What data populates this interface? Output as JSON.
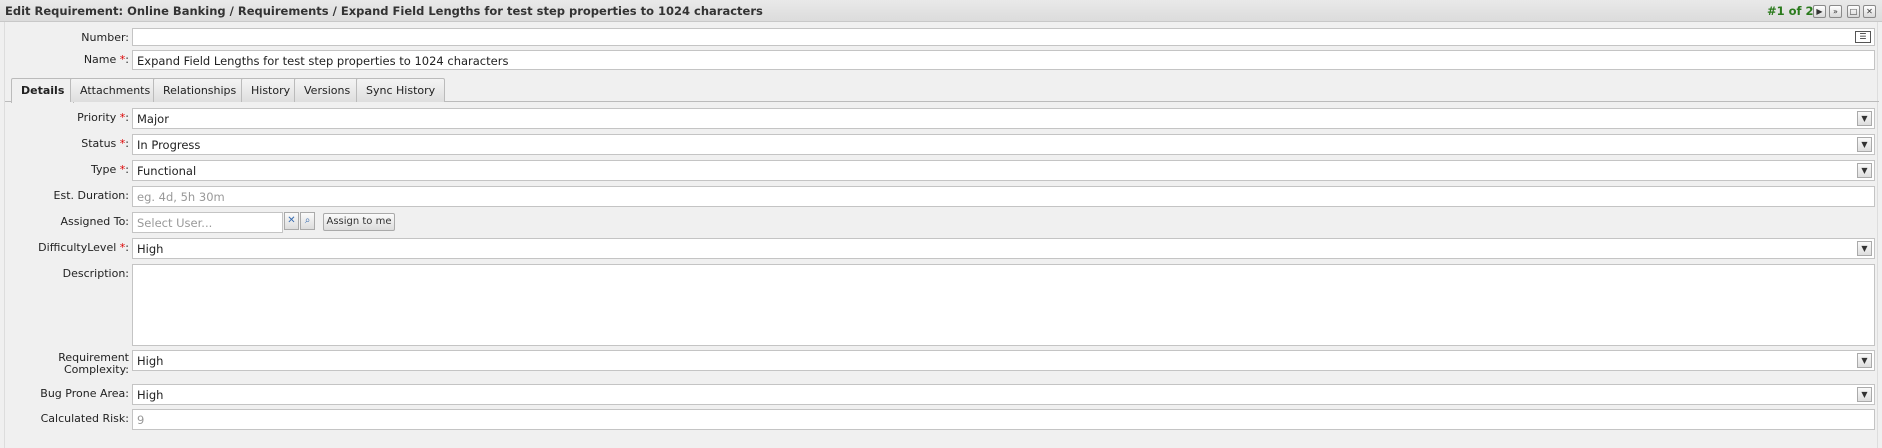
{
  "window": {
    "title": "Edit Requirement: Online Banking / Requirements / Expand Field Lengths for test step properties to 1024 characters",
    "record_counter": "#1 of 2"
  },
  "colors": {
    "accent_green": "#2a7a1c",
    "required_marker": "#d00000"
  },
  "titlebar_buttons": [
    {
      "name": "next-icon",
      "glyph": "▶"
    },
    {
      "name": "last-icon",
      "glyph": "»"
    },
    {
      "name": "maximize-icon",
      "glyph": "□"
    },
    {
      "name": "close-icon",
      "glyph": "✕"
    }
  ],
  "form": {
    "number_label": "Number:",
    "number_value": "",
    "name_label": "Name",
    "name_value": "Expand Field Lengths for test step properties to 1024 characters",
    "required_mark": "*",
    "colon": ":"
  },
  "tabs": [
    "Details",
    "Attachments",
    "Relationships",
    "History",
    "Versions",
    "Sync History"
  ],
  "details": {
    "priority_label": "Priority",
    "priority_value": "Major",
    "status_label": "Status",
    "status_value": "In Progress",
    "type_label": "Type",
    "type_value": "Functional",
    "est_duration_label": "Est. Duration:",
    "est_duration_placeholder": "eg. 4d, 5h 30m",
    "assigned_to_label": "Assigned To:",
    "assigned_to_placeholder": "Select User...",
    "assign_to_me_label": "Assign to me",
    "difficulty_label": "DifficultyLevel",
    "difficulty_value": "High",
    "description_label": "Description:",
    "description_value": "",
    "req_complexity_label_1": "Requirement",
    "req_complexity_label_2": "Complexity:",
    "req_complexity_value": "High",
    "bug_prone_label": "Bug Prone Area:",
    "bug_prone_value": "High",
    "calculated_risk_label": "Calculated Risk:",
    "calculated_risk_value": "9"
  }
}
